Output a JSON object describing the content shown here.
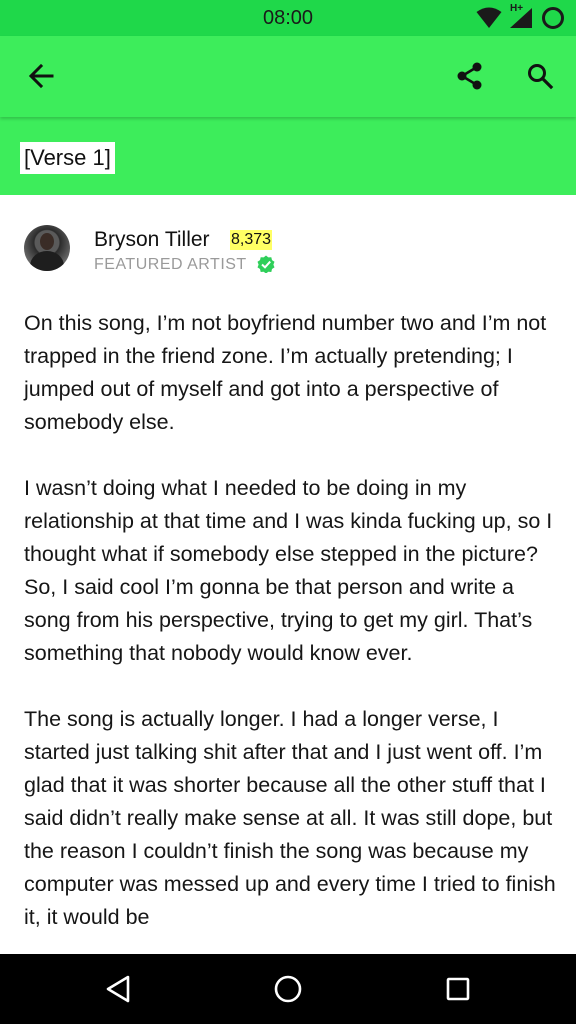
{
  "status_bar": {
    "time": "08:00",
    "network_type": "H+"
  },
  "toolbar": {
    "back_icon": "arrow-left-icon",
    "share_icon": "share-icon",
    "search_icon": "search-icon"
  },
  "header": {
    "section_label": "[Verse 1]"
  },
  "annotation": {
    "artist_name": "Bryson Tiller",
    "iq_score": "8,373",
    "artist_role": "FEATURED ARTIST",
    "paragraphs": [
      "On this song, I’m not boyfriend number two and I’m not trapped in the friend zone. I’m actually pretending; I jumped out of myself and got into a perspective of somebody else.",
      "I wasn’t doing what I needed to be doing in my relationship at that time and I was kinda fucking up, so I thought what if somebody else stepped in the picture? So, I said cool I’m gonna be that person and write a song from his perspective, trying to get my girl. That’s something that nobody would know ever.",
      "The song is actually longer. I had a longer verse, I started just talking shit after that and I just went off. I’m glad that it was shorter because all the other stuff that I said didn’t really make sense at all. It was still dope, but the reason I couldn’t finish the song was because my computer was messed up and every time I tried to finish it, it would be"
    ]
  },
  "colors": {
    "accent_green": "#3ded5b",
    "status_green": "#1fd84a",
    "iq_highlight": "#ffff64",
    "verified_green": "#2fcf5a"
  }
}
